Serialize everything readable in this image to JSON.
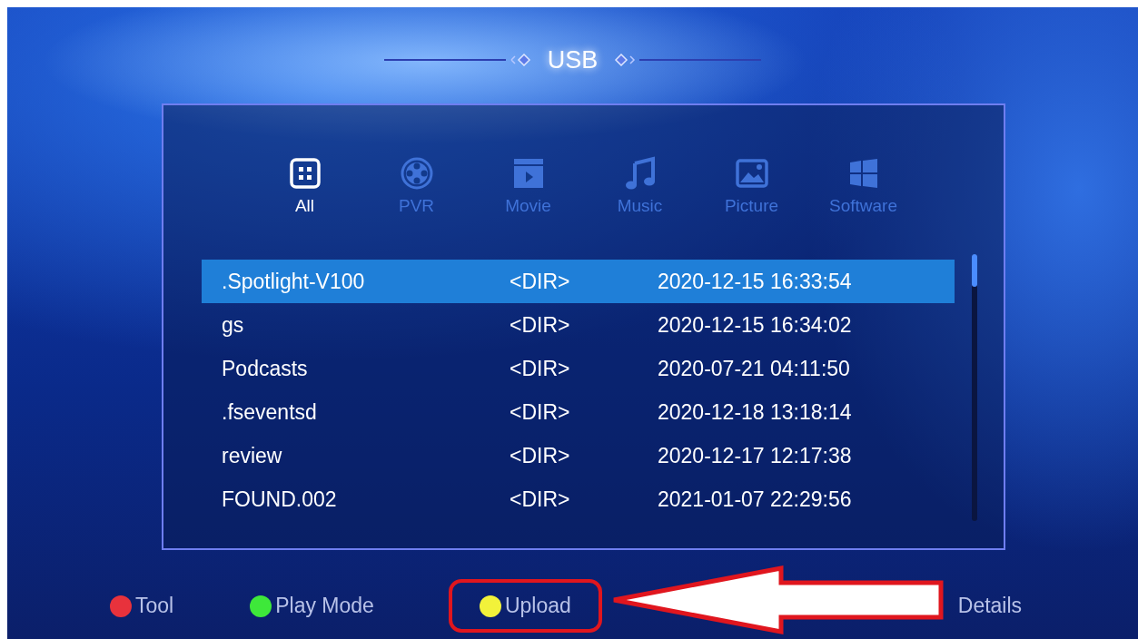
{
  "title": "USB",
  "categories": [
    {
      "label": "All",
      "kind": "all",
      "selected": true
    },
    {
      "label": "PVR",
      "kind": "pvr",
      "selected": false
    },
    {
      "label": "Movie",
      "kind": "movie",
      "selected": false
    },
    {
      "label": "Music",
      "kind": "music",
      "selected": false
    },
    {
      "label": "Picture",
      "kind": "picture",
      "selected": false
    },
    {
      "label": "Software",
      "kind": "software",
      "selected": false
    }
  ],
  "files": [
    {
      "name": ".Spotlight-V100",
      "type": "<DIR>",
      "modified": "2020-12-15 16:33:54",
      "selected": true
    },
    {
      "name": "gs",
      "type": "<DIR>",
      "modified": "2020-12-15 16:34:02",
      "selected": false
    },
    {
      "name": "Podcasts",
      "type": "<DIR>",
      "modified": "2020-07-21 04:11:50",
      "selected": false
    },
    {
      "name": ".fseventsd",
      "type": "<DIR>",
      "modified": "2020-12-18 13:18:14",
      "selected": false
    },
    {
      "name": "review",
      "type": "<DIR>",
      "modified": "2020-12-17 12:17:38",
      "selected": false
    },
    {
      "name": "FOUND.002",
      "type": "<DIR>",
      "modified": "2021-01-07 22:29:56",
      "selected": false
    }
  ],
  "keys": [
    {
      "label": "Tool",
      "color": "#e8323c"
    },
    {
      "label": "Play Mode",
      "color": "#3ee83a"
    },
    {
      "label": "Upload",
      "color": "#f2f23a",
      "highlighted": true
    },
    {
      "label": "Details"
    }
  ]
}
